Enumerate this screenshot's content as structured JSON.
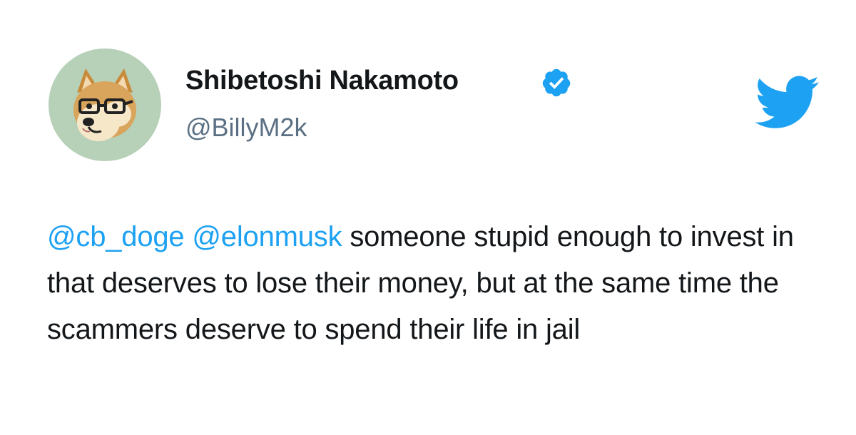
{
  "author": {
    "display_name": "Shibetoshi Nakamoto",
    "handle": "@BillyM2k",
    "verified": true,
    "avatar_icon": "shiba-doge-with-glasses-avatar"
  },
  "brand": {
    "icon": "twitter-bird-icon",
    "color": "#1da1f2"
  },
  "tweet": {
    "mentions": [
      "@cb_doge",
      "@elonmusk"
    ],
    "text": "someone stupid enough to invest in that deserves to lose their money, but at the same time the scammers deserve to spend their life in jail"
  },
  "colors": {
    "mention": "#1da1f2",
    "verified_badge": "#1da1f2",
    "handle": "#5b7083",
    "text": "#14171a",
    "avatar_bg": "#b7d0b8"
  }
}
